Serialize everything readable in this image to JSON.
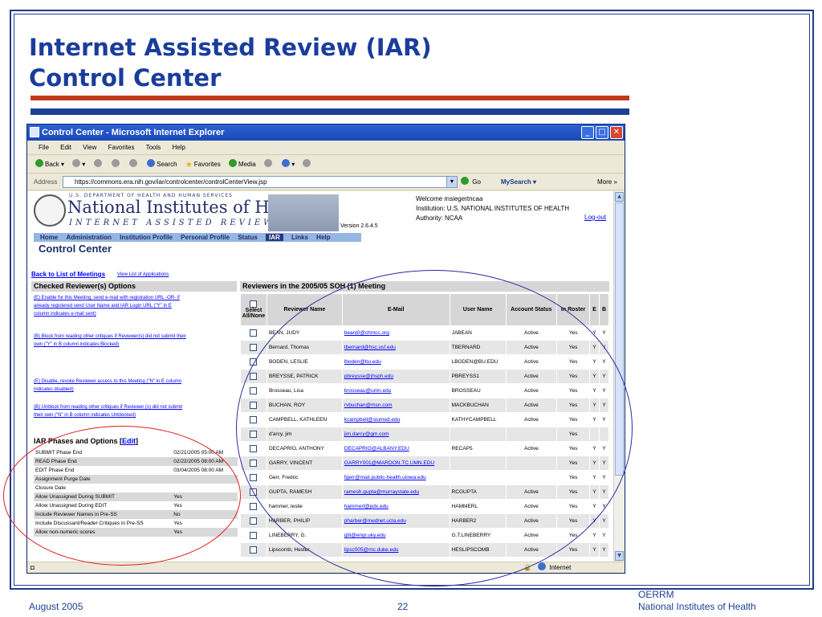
{
  "slide": {
    "title_line1": "Internet Assisted Review (IAR)",
    "title_line2": "Control Center",
    "footer_date": "August  2005",
    "footer_page": "22",
    "footer_org_line1": "OERRM",
    "footer_org_line2": "National Institutes of Health",
    "colors": {
      "title": "#1a3d9c",
      "rule_red": "#c0391b",
      "rule_blue": "#1d3f95"
    }
  },
  "browser": {
    "window_title": "Control Center - Microsoft Internet Explorer",
    "menu": [
      "File",
      "Edit",
      "View",
      "Favorites",
      "Tools",
      "Help"
    ],
    "toolbar": {
      "back": "Back",
      "search": "Search",
      "favorites": "Favorites",
      "media": "Media"
    },
    "address_label": "Address",
    "address_url": "https://commons.era.nih.gov/iar/controlcenter/controlCenterView.jsp",
    "go_label": "Go",
    "mysearch_label": "Search",
    "more_label": "More",
    "status_zone": "Internet"
  },
  "header": {
    "hhs_line": "U.S. DEPARTMENT OF HEALTH AND HUMAN SERVICES",
    "nih_name": "National Institutes of Health",
    "iar_line": "INTERNET ASSISTED REVIEW",
    "version": "Version 2.6.4.5",
    "welcome": "Welcome  msiegertncaa",
    "institution": "Institution: U.S. NATIONAL INSTITUTES OF HEALTH",
    "authority": "Authority:   NCAA",
    "logout": "Log-out"
  },
  "nav": {
    "items": [
      "Home",
      "Administration",
      "Institution Profile",
      "Personal Profile",
      "Status",
      "IAR",
      "Links",
      "Help"
    ]
  },
  "page": {
    "title": "Control Center",
    "back_link": "Back to List of Meetings",
    "apps_link": "View List of Applications"
  },
  "left_panel": {
    "header": "Checked Reviewer(s) Options",
    "options": [
      "(E) Enable for this Meeting, send e-mail with registration URL -OR- if already registered send User Name and IAR Login URL (\"Y\" in E column indicates e-mail sent)",
      "(B) Block from reading other critiques if Reviewer(s) did not submit their own (\"Y\" in B column indicates Blocked)",
      "(E) Disable, revoke Reviewer access to this Meeting (\"N\" in E column indicates disabled)",
      "(B) Unblock from reading other critiques if Reviewer (s) did not submit their own (\"N\" in B column indicates Unblocked)"
    ]
  },
  "phases": {
    "header": "IAR Phases and Options [",
    "edit": "Edit",
    "header_end": "]",
    "rows": [
      {
        "label": "SUBMIT Phase End",
        "value": "02/21/2005 05:00 AM"
      },
      {
        "label": "READ Phase End",
        "value": "02/22/2005 08:00 AM"
      },
      {
        "label": "EDIT Phase End",
        "value": "03/04/2005 08:00 AM"
      },
      {
        "label": "Assignment Purge Date",
        "value": ""
      },
      {
        "label": "Closure Date",
        "value": ""
      },
      {
        "label": "Allow Unassigned During SUBMIT",
        "value": "Yes"
      },
      {
        "label": "Allow Unassigned During EDIT",
        "value": "Yes"
      },
      {
        "label": "Include Reviewer Names in Pre-SS",
        "value": "No"
      },
      {
        "label": "Include Discussant/Reader Critiques in Pre-SS",
        "value": "Yes"
      },
      {
        "label": "Allow non-numeric scores",
        "value": "Yes"
      }
    ]
  },
  "reviewers": {
    "header": "Reviewers in the 2005/05 SOH (1) Meeting",
    "columns": [
      "Select All/None",
      "Reviewer Name",
      "E-Mail",
      "User Name",
      "Account Status",
      "In Roster",
      "E",
      "B"
    ],
    "rows": [
      {
        "name": "BEAN, JUDY",
        "email": "beanj0@chmcc.org",
        "user": "JABEAN",
        "status": "Active",
        "roster": "Yes",
        "e": "Y",
        "b": "Y"
      },
      {
        "name": "Bernard, Thomas",
        "email": "tbernard@hsc.usf.edu",
        "user": "TBERNARD",
        "status": "Active",
        "roster": "Yes",
        "e": "Y",
        "b": "Y"
      },
      {
        "name": "BODEN, LESLIE",
        "email": "lboden@bu.edu",
        "user": "LBODEN@BU.EDU",
        "status": "Active",
        "roster": "Yes",
        "e": "Y",
        "b": "Y"
      },
      {
        "name": "BREYSSE, PATRICK",
        "email": "pbreysse@jhsph.edu",
        "user": "PBREYSS1",
        "status": "Active",
        "roster": "Yes",
        "e": "Y",
        "b": "Y"
      },
      {
        "name": "Brosseau, Lisa",
        "email": "brosseau@umn.edu",
        "user": "BROSSEAU",
        "status": "Active",
        "roster": "Yes",
        "e": "Y",
        "b": "Y"
      },
      {
        "name": "BUCHAN, ROY",
        "email": "rvbuchan@msn.com",
        "user": "MACKBUCHAN",
        "status": "Active",
        "roster": "Yes",
        "e": "Y",
        "b": "Y"
      },
      {
        "name": "CAMPBELL, KATHLEEN",
        "email": "kcampbell@siumed.edu",
        "user": "KATHYCAMPBELL",
        "status": "Active",
        "roster": "Yes",
        "e": "Y",
        "b": "Y"
      },
      {
        "name": "d'arcy, jim",
        "email": "jim.darcy@gm.com",
        "user": "",
        "status": "",
        "roster": "Yes",
        "e": "",
        "b": ""
      },
      {
        "name": "DECAPRIO, ANTHONY",
        "email": "DECAPRIO@ALBANY.EDU",
        "user": "RECAP5",
        "status": "Active",
        "roster": "Yes",
        "e": "Y",
        "b": "Y"
      },
      {
        "name": "GARRY, VINCENT",
        "email": "GARRY001@MAROON.TC.UMN.EDU",
        "user": "",
        "status": "",
        "roster": "Yes",
        "e": "Y",
        "b": "Y"
      },
      {
        "name": "Gerr, Fredric",
        "email": "fgerr@mail.public-health.uiowa.edu",
        "user": "",
        "status": "",
        "roster": "Yes",
        "e": "Y",
        "b": "Y"
      },
      {
        "name": "GUPTA, RAMESH",
        "email": "ramesh.gupta@murraystate.edu",
        "user": "RCGUPTA",
        "status": "Active",
        "roster": "Yes",
        "e": "Y",
        "b": "Y"
      },
      {
        "name": "hammer, leslie",
        "email": "hammerl@pdx.edu",
        "user": "HAMMERL",
        "status": "Active",
        "roster": "Yes",
        "e": "Y",
        "b": "Y"
      },
      {
        "name": "HARBER, PHILIP",
        "email": "pharber@mednet.ucla.edu",
        "user": "HARBER2",
        "status": "Active",
        "roster": "Yes",
        "e": "Y",
        "b": "Y"
      },
      {
        "name": "LINEBERRY, G.",
        "email": "gtli@engr.uky.edu",
        "user": "G.T.LINEBERRY",
        "status": "Active",
        "roster": "Yes",
        "e": "Y",
        "b": "Y"
      },
      {
        "name": "Lipscomb, Hester",
        "email": "lipsc005@mc.duke.edu",
        "user": "HESLIPSCOMB",
        "status": "Active",
        "roster": "Yes",
        "e": "Y",
        "b": "Y"
      }
    ]
  },
  "annotations": {
    "ellipse_left_color": "#e02020",
    "ellipse_right_color": "#2a2aa0"
  }
}
